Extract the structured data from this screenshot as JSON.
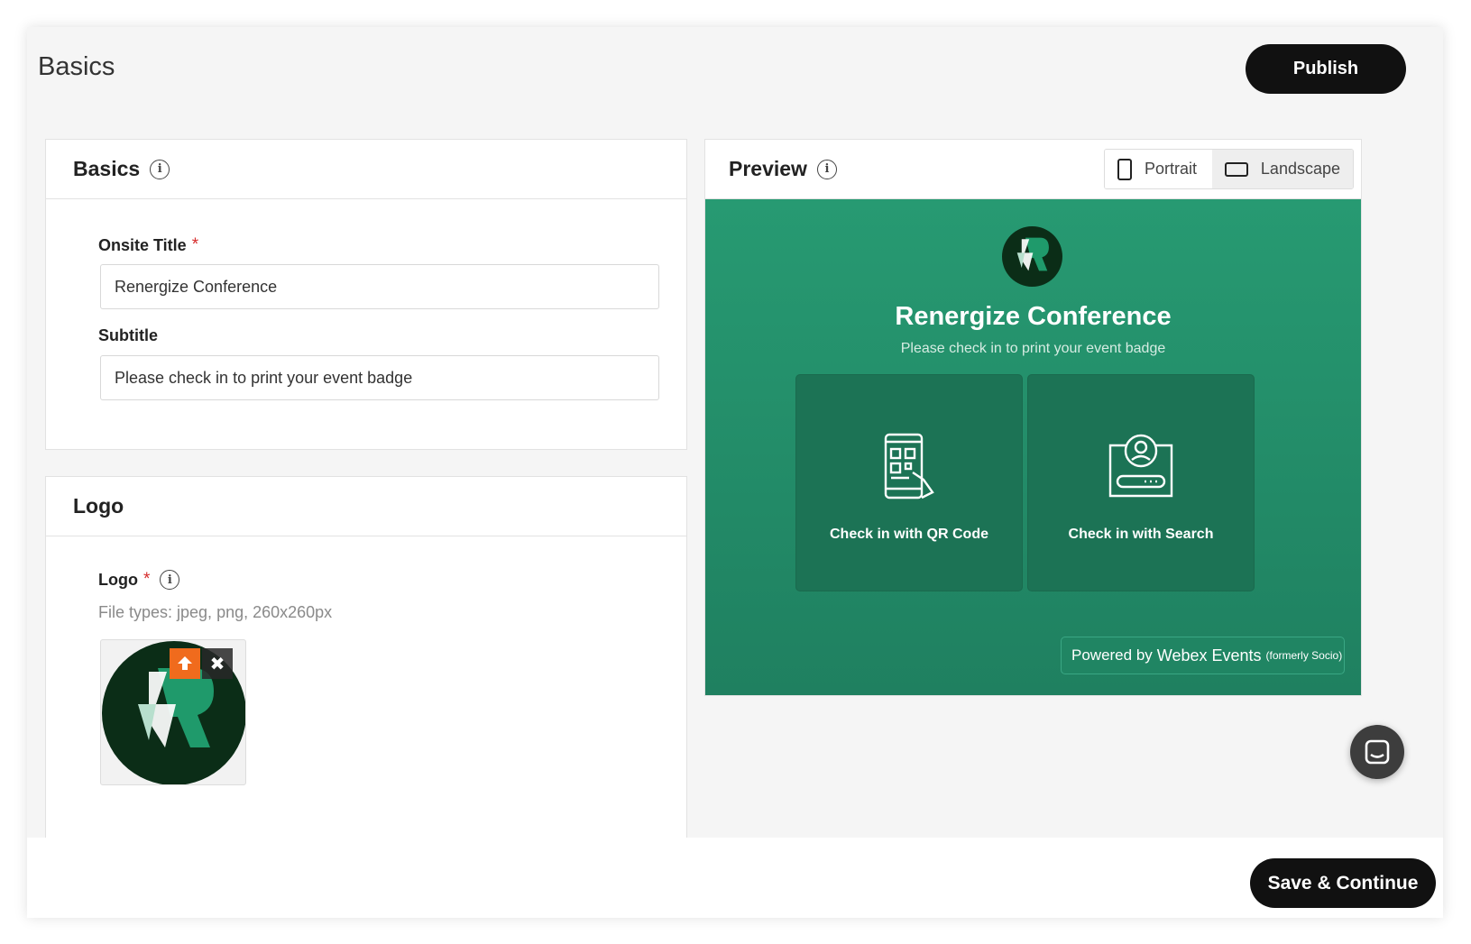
{
  "header": {
    "title": "Basics",
    "publish_label": "Publish"
  },
  "basics_card": {
    "title": "Basics",
    "info_icon": "info-icon",
    "onsite_title": {
      "label": "Onsite Title",
      "required_mark": "*",
      "value": "Renergize Conference"
    },
    "subtitle": {
      "label": "Subtitle",
      "value": "Please check in to print your event badge"
    }
  },
  "logo_card": {
    "title": "Logo",
    "field_label": "Logo",
    "required_mark": "*",
    "file_types": "File types: jpeg, png, 260x260px",
    "upload_icon": "upload-icon",
    "remove_icon": "close-icon"
  },
  "preview_card": {
    "title": "Preview",
    "orientation": {
      "portrait_label": "Portrait",
      "landscape_label": "Landscape",
      "selected": "Landscape"
    },
    "screen": {
      "title": "Renergize Conference",
      "subtitle": "Please check in to print your event badge",
      "tiles": [
        {
          "label": "Check in with QR Code",
          "icon": "qr-phone-icon"
        },
        {
          "label": "Check in with Search",
          "icon": "search-person-icon"
        }
      ],
      "powered_by": "Powered by",
      "powered_brand": "Webex Events",
      "powered_note": "(formerly Socio)"
    },
    "colors": {
      "preview_bg": "#279a72",
      "tile_bg": "#1c7355",
      "logo_bg": "#0b2d17"
    }
  },
  "footer": {
    "save_label": "Save & Continue"
  },
  "chat_widget": {
    "icon": "chat-icon"
  }
}
